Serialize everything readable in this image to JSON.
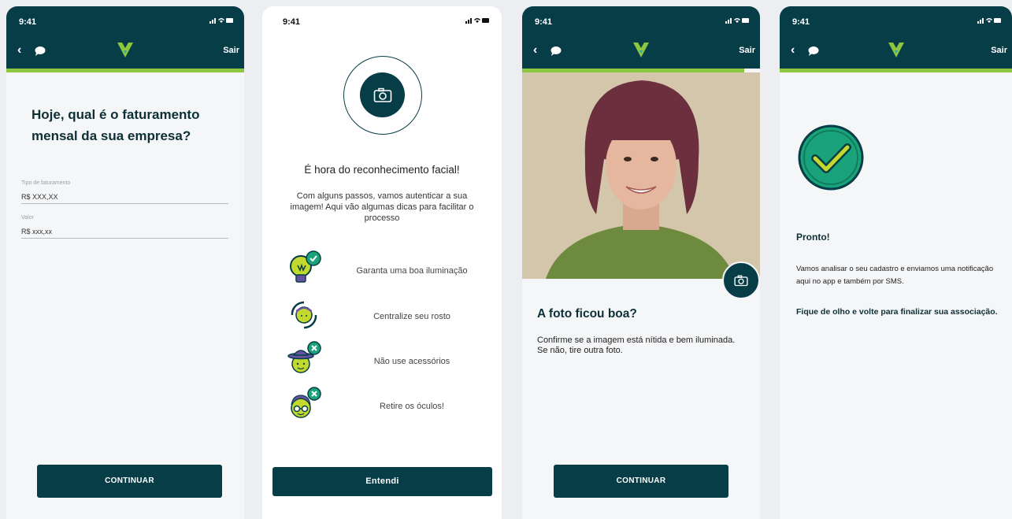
{
  "status_time": "9:41",
  "header": {
    "back_glyph": "‹",
    "exit_label": "Sair"
  },
  "screen1": {
    "title": "Hoje, qual é o faturamento mensal da sua empresa?",
    "fields": [
      {
        "label": "Tipo de faturamento",
        "value": "R$ XXX,XX"
      },
      {
        "label": "Valor",
        "value": "R$ xxx,xx"
      }
    ],
    "button": "CONTINUAR"
  },
  "screen2": {
    "title": "É hora do reconhecimento facial!",
    "text": "Com alguns passos, vamos autenticar a sua imagem! Aqui vão algumas dicas para facilitar o processo",
    "tips": [
      {
        "label": "Garanta uma boa iluminação",
        "icon": "lightbulb-check-icon"
      },
      {
        "label": "Centralize seu rosto",
        "icon": "face-center-icon"
      },
      {
        "label": "Não use acessórios",
        "icon": "hat-face-x-icon"
      },
      {
        "label": "Retire os óculos!",
        "icon": "glasses-face-x-icon"
      }
    ],
    "button": "Entendi"
  },
  "screen3": {
    "title": "A foto ficou boa?",
    "text": "Confirme se a imagem está nítida e bem iluminada. Se não, tire outra foto.",
    "button": "CONTINUAR"
  },
  "screen4": {
    "title": "Pronto!",
    "text": "Vamos analisar o seu cadastro e enviamos uma notificação aqui no app e também por SMS.",
    "bold_text": "Fique de olho e volte para finalizar sua associação."
  },
  "colors": {
    "primary": "#063d47",
    "accent_green": "#8dc63f",
    "check_green": "#1aa37a"
  }
}
